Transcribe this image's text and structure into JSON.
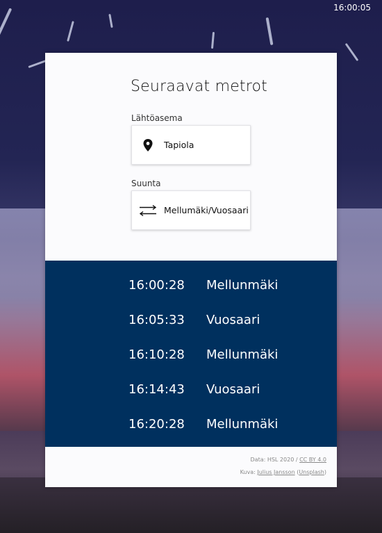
{
  "clock": "16:00:05",
  "title": "Seuraavat metrot",
  "origin": {
    "label": "Lähtöasema",
    "value": "Tapiola",
    "icon": "location-pin-icon"
  },
  "direction": {
    "label": "Suunta",
    "value": "Mellumäki/Vuosaari",
    "icon": "swap-arrows-icon"
  },
  "departures": [
    {
      "time": "16:00:28",
      "destination": "Mellunmäki"
    },
    {
      "time": "16:05:33",
      "destination": "Vuosaari"
    },
    {
      "time": "16:10:28",
      "destination": "Mellunmäki"
    },
    {
      "time": "16:14:43",
      "destination": "Vuosaari"
    },
    {
      "time": "16:20:28",
      "destination": "Mellunmäki"
    }
  ],
  "footer": {
    "data_prefix": "Data: HSL 2020 / ",
    "license": "CC BY 4.0",
    "photo_prefix": "Kuva: ",
    "photographer": "Julius Jansson",
    "source_open": " (",
    "source": "Unsplash",
    "source_close": ")"
  },
  "colors": {
    "departures_bg": "#00305e",
    "card_bg": "#fbfbfd"
  }
}
